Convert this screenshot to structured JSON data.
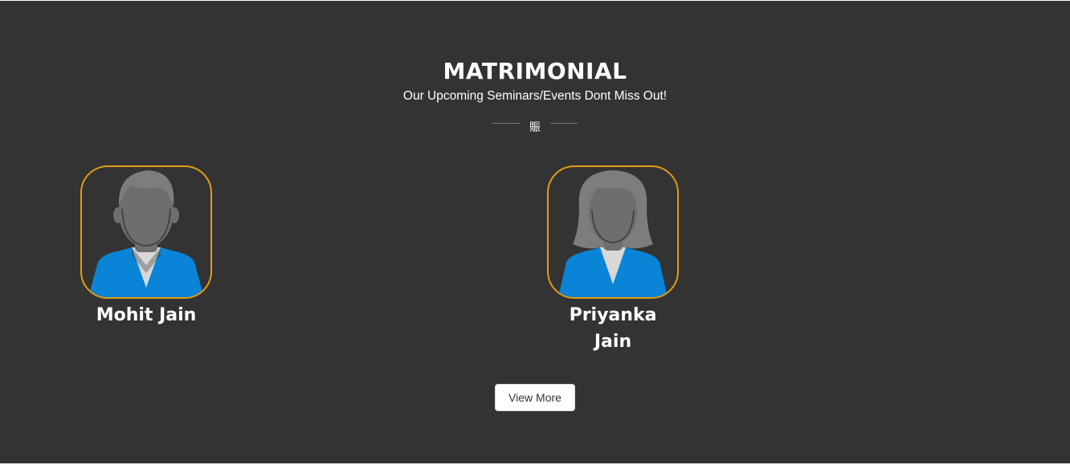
{
  "section": {
    "title": "MATRIMONIAL",
    "subtitle": "Our Upcoming Seminars/Events Dont Miss Out!",
    "divider_glyph": "賑"
  },
  "profiles": [
    {
      "name": "Mohit Jain",
      "avatar_icon": "male-avatar-icon"
    },
    {
      "name": "Priyanka Jain",
      "avatar_icon": "female-avatar-icon"
    }
  ],
  "actions": {
    "view_more_label": "View More"
  },
  "colors": {
    "background": "#333333",
    "avatar_border": "#e39c13",
    "shirt": "#0a84d6",
    "head": "#6e6e6e",
    "text": "#ffffff"
  }
}
